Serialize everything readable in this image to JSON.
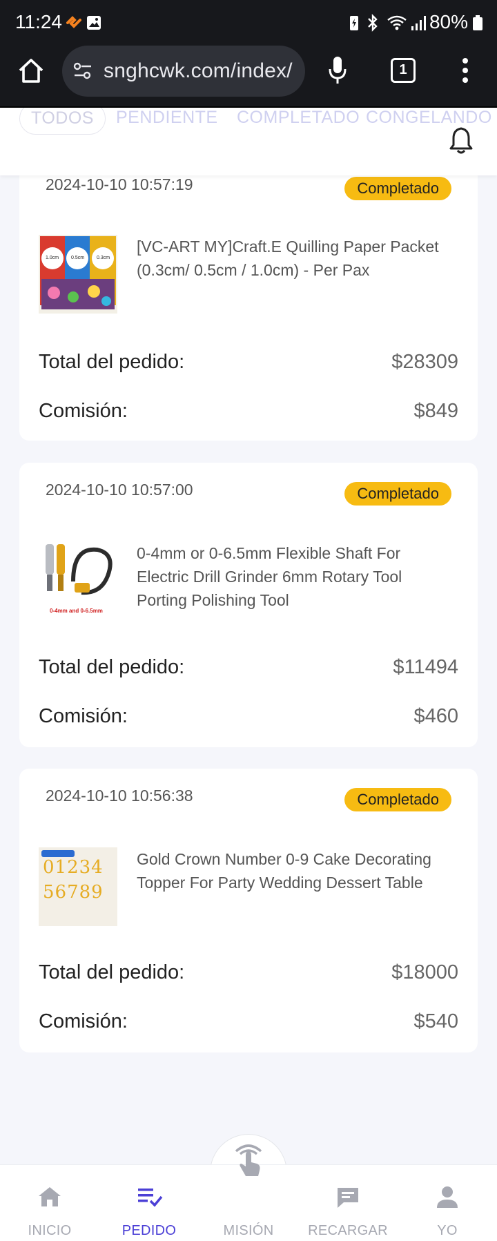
{
  "status_bar": {
    "time": "11:24",
    "battery": "80%"
  },
  "browser": {
    "url": "snghcwk.com/index/",
    "tab_count": "1"
  },
  "tabs": [
    {
      "label": "TODOS",
      "active": true
    },
    {
      "label": "PENDIENTE"
    },
    {
      "label": "COMPLETADO"
    },
    {
      "label": "CONGELANDO"
    }
  ],
  "orders": [
    {
      "date": "2024-10-10 10:57:19",
      "status": "Completado",
      "product_name": "[VC-ART MY]Craft.E Quilling Paper Packet (0.3cm/ 0.5cm / 1.0cm) - Per Pax",
      "total_label": "Total del pedido:",
      "total_value": "$28309",
      "commission_label": "Comisión:",
      "commission_value": "$849",
      "thumb_labels": [
        "1.0cm",
        "0.5cm",
        "0.3cm"
      ]
    },
    {
      "date": "2024-10-10 10:57:00",
      "status": "Completado",
      "product_name": "0-4mm or 0-6.5mm Flexible Shaft For Electric Drill Grinder 6mm Rotary Tool Porting Polishing Tool",
      "total_label": "Total del pedido:",
      "total_value": "$11494",
      "commission_label": "Comisión:",
      "commission_value": "$460",
      "thumb_caption": "0-4mm and 0-6.5mm"
    },
    {
      "date": "2024-10-10 10:56:38",
      "status": "Completado",
      "product_name": "Gold Crown Number 0-9 Cake Decorating Topper For Party Wedding Dessert Table",
      "total_label": "Total del pedido:",
      "total_value": "$18000",
      "commission_label": "Comisión:",
      "commission_value": "$540",
      "thumb_digits_top": "01234",
      "thumb_digits_bottom": "56789"
    }
  ],
  "bottom_nav": [
    {
      "label": "INICIO",
      "icon": "home-icon"
    },
    {
      "label": "PEDIDO",
      "icon": "order-list-icon",
      "active": true
    },
    {
      "label": "MISIÓN",
      "icon": "tap-hand-icon"
    },
    {
      "label": "RECARGAR",
      "icon": "chat-icon"
    },
    {
      "label": "YO",
      "icon": "person-icon"
    }
  ],
  "colors": {
    "accent": "#4b3fd6",
    "badge": "#f7bb12",
    "status_bar_bg": "#17181c",
    "page_bg": "#f5f6fb"
  }
}
